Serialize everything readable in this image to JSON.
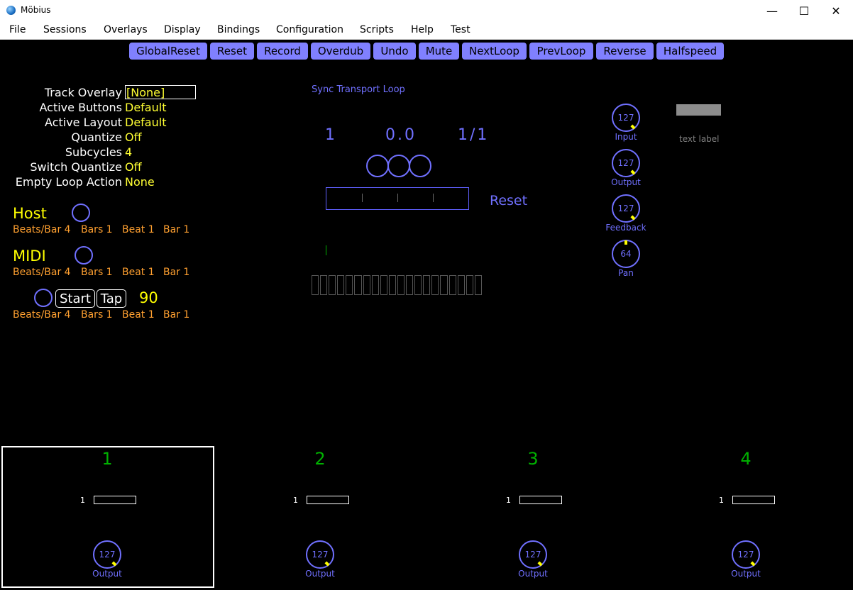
{
  "window": {
    "title": "Möbius",
    "minimize": "—",
    "maximize": "☐",
    "close": "✕"
  },
  "menu": [
    "File",
    "Sessions",
    "Overlays",
    "Display",
    "Bindings",
    "Configuration",
    "Scripts",
    "Help",
    "Test"
  ],
  "actions": [
    "GlobalReset",
    "Reset",
    "Record",
    "Overdub",
    "Undo",
    "Mute",
    "NextLoop",
    "PrevLoop",
    "Reverse",
    "Halfspeed"
  ],
  "params": [
    {
      "label": "Track Overlay",
      "value": "[None]"
    },
    {
      "label": "Active Buttons",
      "value": "Default"
    },
    {
      "label": "Active Layout",
      "value": "Default"
    },
    {
      "label": "Quantize",
      "value": "Off"
    },
    {
      "label": "Subcycles",
      "value": "4"
    },
    {
      "label": "Switch Quantize",
      "value": "Off"
    },
    {
      "label": "Empty Loop Action",
      "value": "None"
    }
  ],
  "sync": {
    "host": {
      "label": "Host",
      "beats_bar": "Beats/Bar 4",
      "bars": "Bars 1",
      "beat": "Beat 1",
      "bar": "Bar 1"
    },
    "midi": {
      "label": "MIDI",
      "beats_bar": "Beats/Bar 4",
      "bars": "Bars 1",
      "beat": "Beat 1",
      "bar": "Bar 1"
    },
    "transport": {
      "start": "Start",
      "tap": "Tap",
      "tempo": "90",
      "beats_bar": "Beats/Bar 4",
      "bars": "Bars 1",
      "beat": "Beat 1",
      "bar": "Bar 1"
    }
  },
  "loop": {
    "header": "Sync Transport Loop",
    "loop_number": "1",
    "position": "0.0",
    "cycle": "1/1",
    "mode": "Reset"
  },
  "knobs": [
    {
      "label": "Input",
      "value": "127"
    },
    {
      "label": "Output",
      "value": "127"
    },
    {
      "label": "Feedback",
      "value": "127"
    },
    {
      "label": "Pan",
      "value": "64"
    }
  ],
  "text_label": "text label",
  "tracks": [
    {
      "number": "1",
      "loop": "1",
      "knob_value": "127",
      "knob_label": "Output",
      "selected": true
    },
    {
      "number": "2",
      "loop": "1",
      "knob_value": "127",
      "knob_label": "Output",
      "selected": false
    },
    {
      "number": "3",
      "loop": "1",
      "knob_value": "127",
      "knob_label": "Output",
      "selected": false
    },
    {
      "number": "4",
      "loop": "1",
      "knob_value": "127",
      "knob_label": "Output",
      "selected": false
    }
  ],
  "colors": {
    "accent": "#8080ff",
    "param_value": "#ffff33",
    "sync_text": "#ffa030",
    "track_number": "#00b000",
    "knob_pip": "#ffff00"
  },
  "icons": {
    "app": "mobius-app-icon",
    "minimize": "minimize-icon",
    "maximize": "maximize-icon",
    "close": "close-icon"
  }
}
